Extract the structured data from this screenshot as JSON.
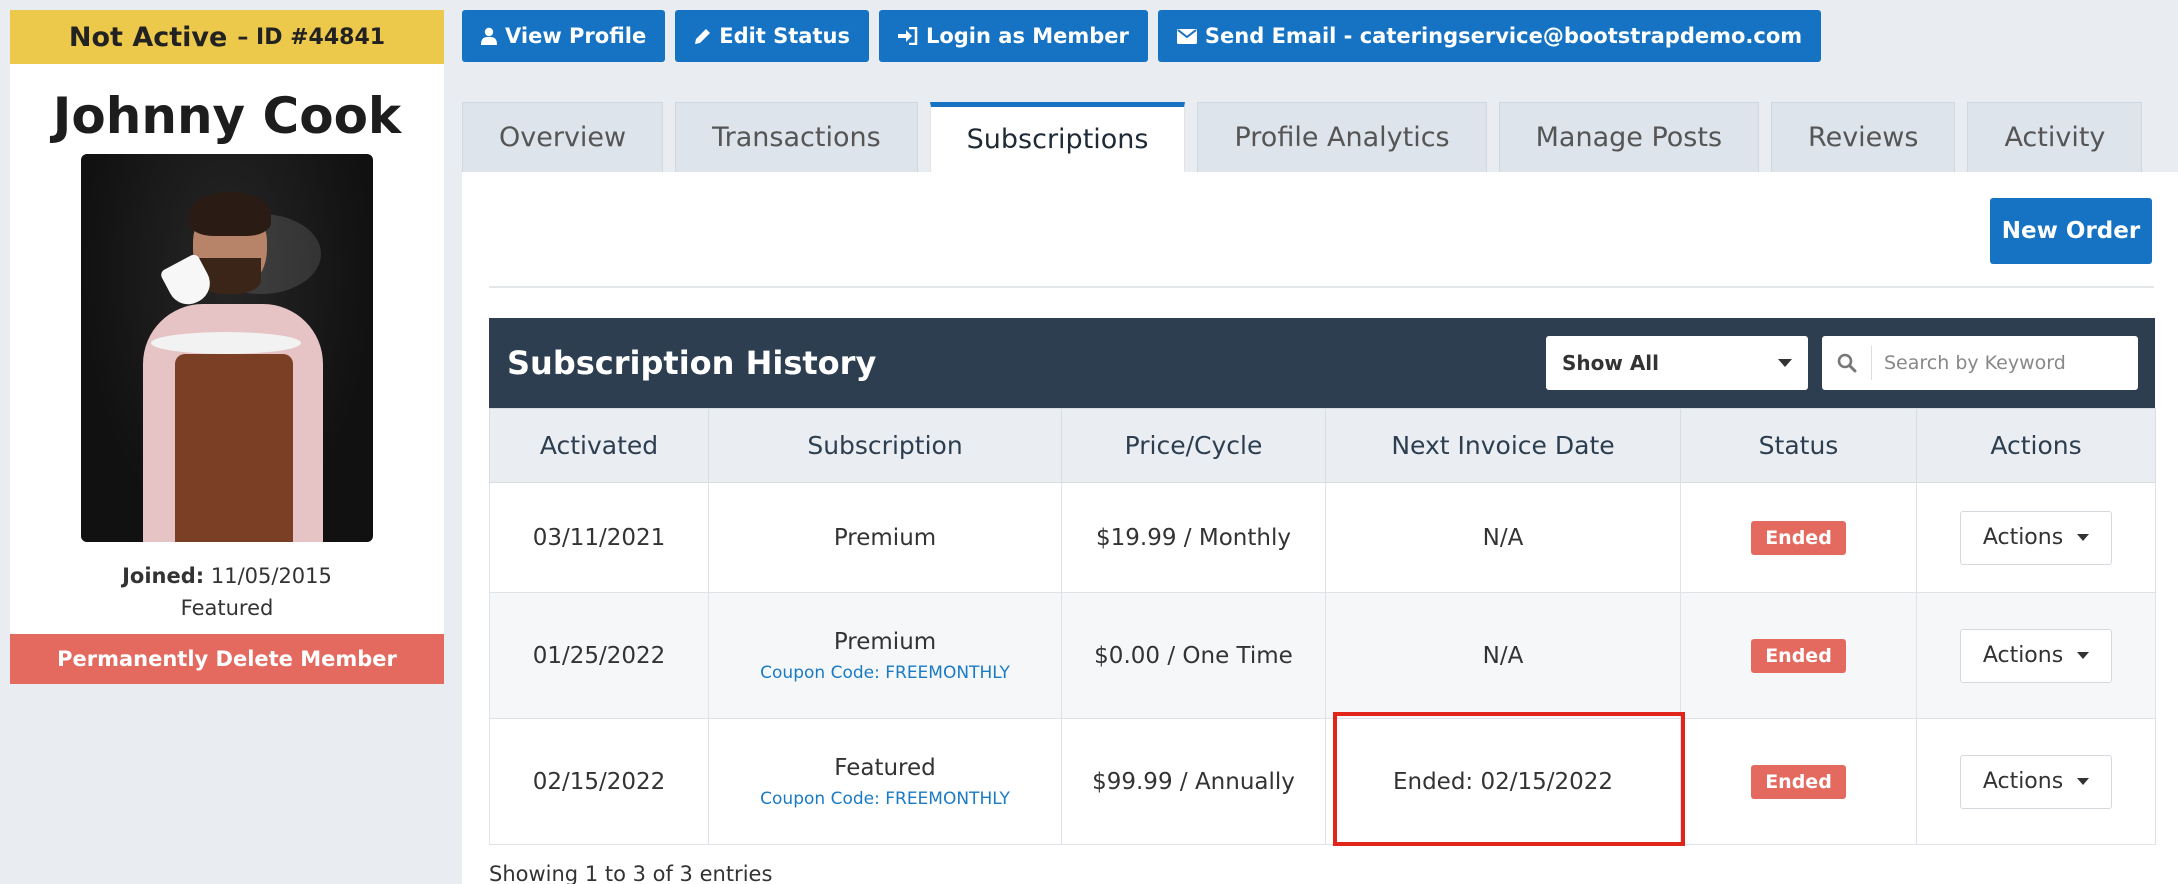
{
  "member": {
    "status": "Not Active",
    "id_label": "– ID #44841",
    "name": "Johnny Cook",
    "joined_label": "Joined:",
    "joined_date": "11/05/2015",
    "plan": "Featured",
    "delete_label": "Permanently Delete Member",
    "status_color": "#ecc94b"
  },
  "top_buttons": [
    {
      "label": "View Profile",
      "icon": "user-icon"
    },
    {
      "label": "Edit Status",
      "icon": "pencil-icon"
    },
    {
      "label": "Login as Member",
      "icon": "sign-in-icon"
    },
    {
      "label": "Send Email - cateringservice@bootstrapdemo.com",
      "icon": "envelope-icon"
    }
  ],
  "tabs": [
    "Overview",
    "Transactions",
    "Subscriptions",
    "Profile Analytics",
    "Manage Posts",
    "Reviews",
    "Activity"
  ],
  "active_tab": "Subscriptions",
  "new_order_label": "New Order",
  "history": {
    "title": "Subscription History",
    "filter_value": "Show All",
    "search_placeholder": "Search by Keyword",
    "columns": [
      "Activated",
      "Subscription",
      "Price/Cycle",
      "Next Invoice Date",
      "Status",
      "Actions"
    ],
    "rows": [
      {
        "activated": "03/11/2021",
        "subscription": "Premium",
        "coupon": "",
        "price": "$19.99 / Monthly",
        "next_invoice": "N/A",
        "status": "Ended",
        "action": "Actions"
      },
      {
        "activated": "01/25/2022",
        "subscription": "Premium",
        "coupon": "Coupon Code: FREEMONTHLY",
        "price": "$0.00 / One Time",
        "next_invoice": "N/A",
        "status": "Ended",
        "action": "Actions"
      },
      {
        "activated": "02/15/2022",
        "subscription": "Featured",
        "coupon": "Coupon Code: FREEMONTHLY",
        "price": "$99.99 / Annually",
        "next_invoice": "Ended: 02/15/2022",
        "status": "Ended",
        "action": "Actions"
      }
    ],
    "footer": "Showing 1 to 3 of 3 entries"
  },
  "colors": {
    "primary": "#1673c3",
    "danger": "#e46a60",
    "header_dark": "#2c3e50",
    "highlight": "#e1251b"
  }
}
